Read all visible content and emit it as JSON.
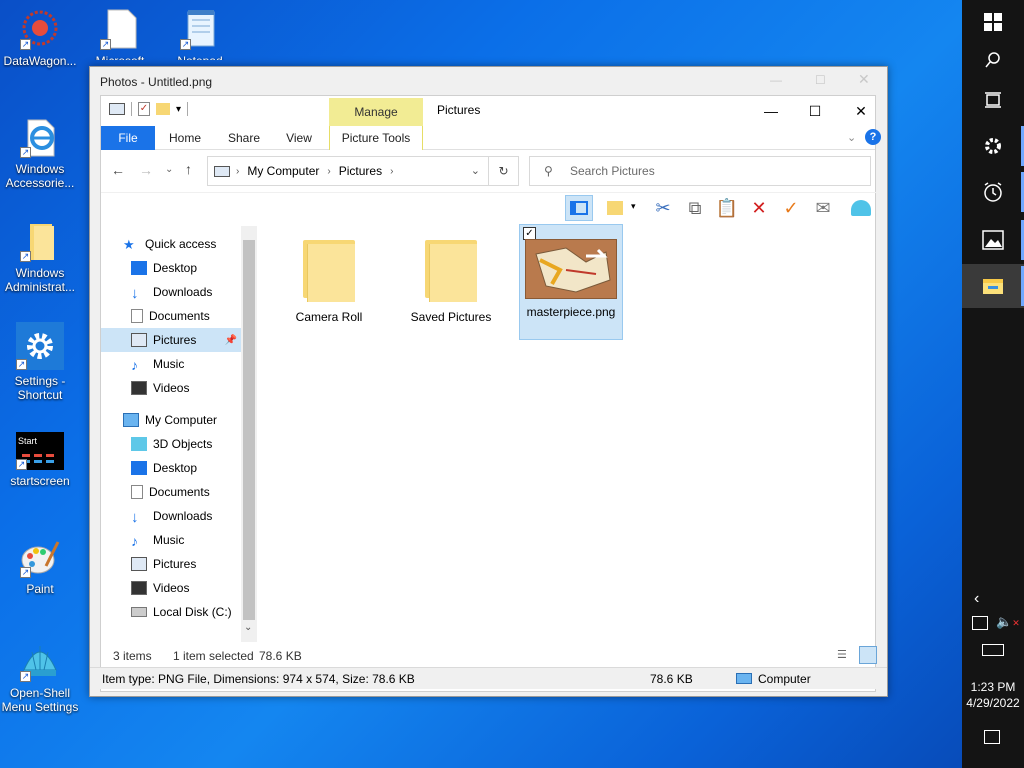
{
  "desktop": {
    "icons": [
      {
        "label": "DataWagon...",
        "icon": "datawagon-icon"
      },
      {
        "label": "Microsoft",
        "icon": "document-icon"
      },
      {
        "label": "Notepad",
        "icon": "notepad-icon"
      },
      {
        "label": "Windows Accessorie...",
        "icon": "ie-icon"
      },
      {
        "label": "Windows Administrat...",
        "icon": "folder-icon"
      },
      {
        "label": "Settings - Shortcut",
        "icon": "gear-icon"
      },
      {
        "label": "startscreen",
        "icon": "startscreen-icon"
      },
      {
        "label": "Paint",
        "icon": "paint-icon"
      },
      {
        "label": "Open-Shell Menu Settings",
        "icon": "shell-icon"
      }
    ],
    "startscreen_badge": "Start"
  },
  "taskbar": {
    "time": "1:23 PM",
    "date": "4/29/2022"
  },
  "photos_window": {
    "title": "Photos - Untitled.png"
  },
  "explorer": {
    "title": "Pictures",
    "manage_tab": "Manage",
    "ribbon_tabs": [
      "File",
      "Home",
      "Share",
      "View",
      "Picture Tools"
    ],
    "address": {
      "segments": [
        "My Computer",
        "Pictures"
      ]
    },
    "search": {
      "placeholder": "Search Pictures"
    },
    "nav": {
      "quick_access": "Quick access",
      "quick_items": [
        "Desktop",
        "Downloads",
        "Documents",
        "Pictures",
        "Music",
        "Videos"
      ],
      "my_computer": "My Computer",
      "computer_items": [
        "3D Objects",
        "Desktop",
        "Documents",
        "Downloads",
        "Music",
        "Pictures",
        "Videos",
        "Local Disk (C:)"
      ]
    },
    "files": [
      {
        "name": "Camera Roll",
        "type": "folder"
      },
      {
        "name": "Saved Pictures",
        "type": "folder"
      },
      {
        "name": "masterpiece.png",
        "type": "image",
        "selected": true
      }
    ],
    "status": {
      "items": "3 items",
      "selected": "1 item selected",
      "size": "78.6 KB"
    }
  },
  "bottom_status": {
    "info": "Item type: PNG File, Dimensions: 974 x 574, Size: 78.6 KB",
    "size": "78.6 KB",
    "location": "Computer"
  },
  "colors": {
    "accent": "#1a73e8",
    "manage": "#f2ec94",
    "selection": "#cce4f7"
  }
}
